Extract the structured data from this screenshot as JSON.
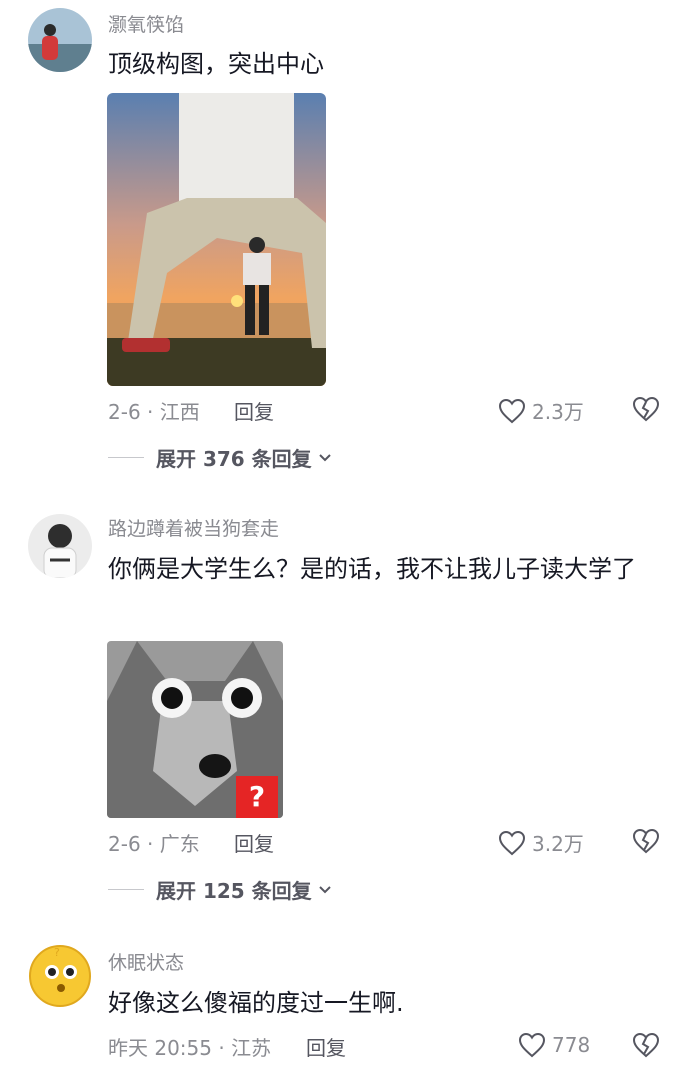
{
  "comments": [
    {
      "username": "灏氧筷馅",
      "text": "顶级构图，突出中心",
      "date_location": "2-6 · 江西",
      "reply_label": "回复",
      "likes": "2.3万",
      "expand_label": "展开 376 条回复"
    },
    {
      "username": "路边蹲着被当狗套走",
      "text": "你俩是大学生么？是的话，我不让我儿子读大学了",
      "date_location": "2-6 · 广东",
      "reply_label": "回复",
      "likes": "3.2万",
      "expand_label": "展开 125 条回复",
      "sticker_badge": "?"
    },
    {
      "username": "休眠状态",
      "text": "好像这么傻福的度过一生啊.",
      "date_location": "昨天 20:55 · 江苏",
      "reply_label": "回复",
      "likes": "778"
    }
  ],
  "colors": {
    "text": "#161823",
    "muted": "#8a8b91",
    "badge": "#e52525"
  }
}
